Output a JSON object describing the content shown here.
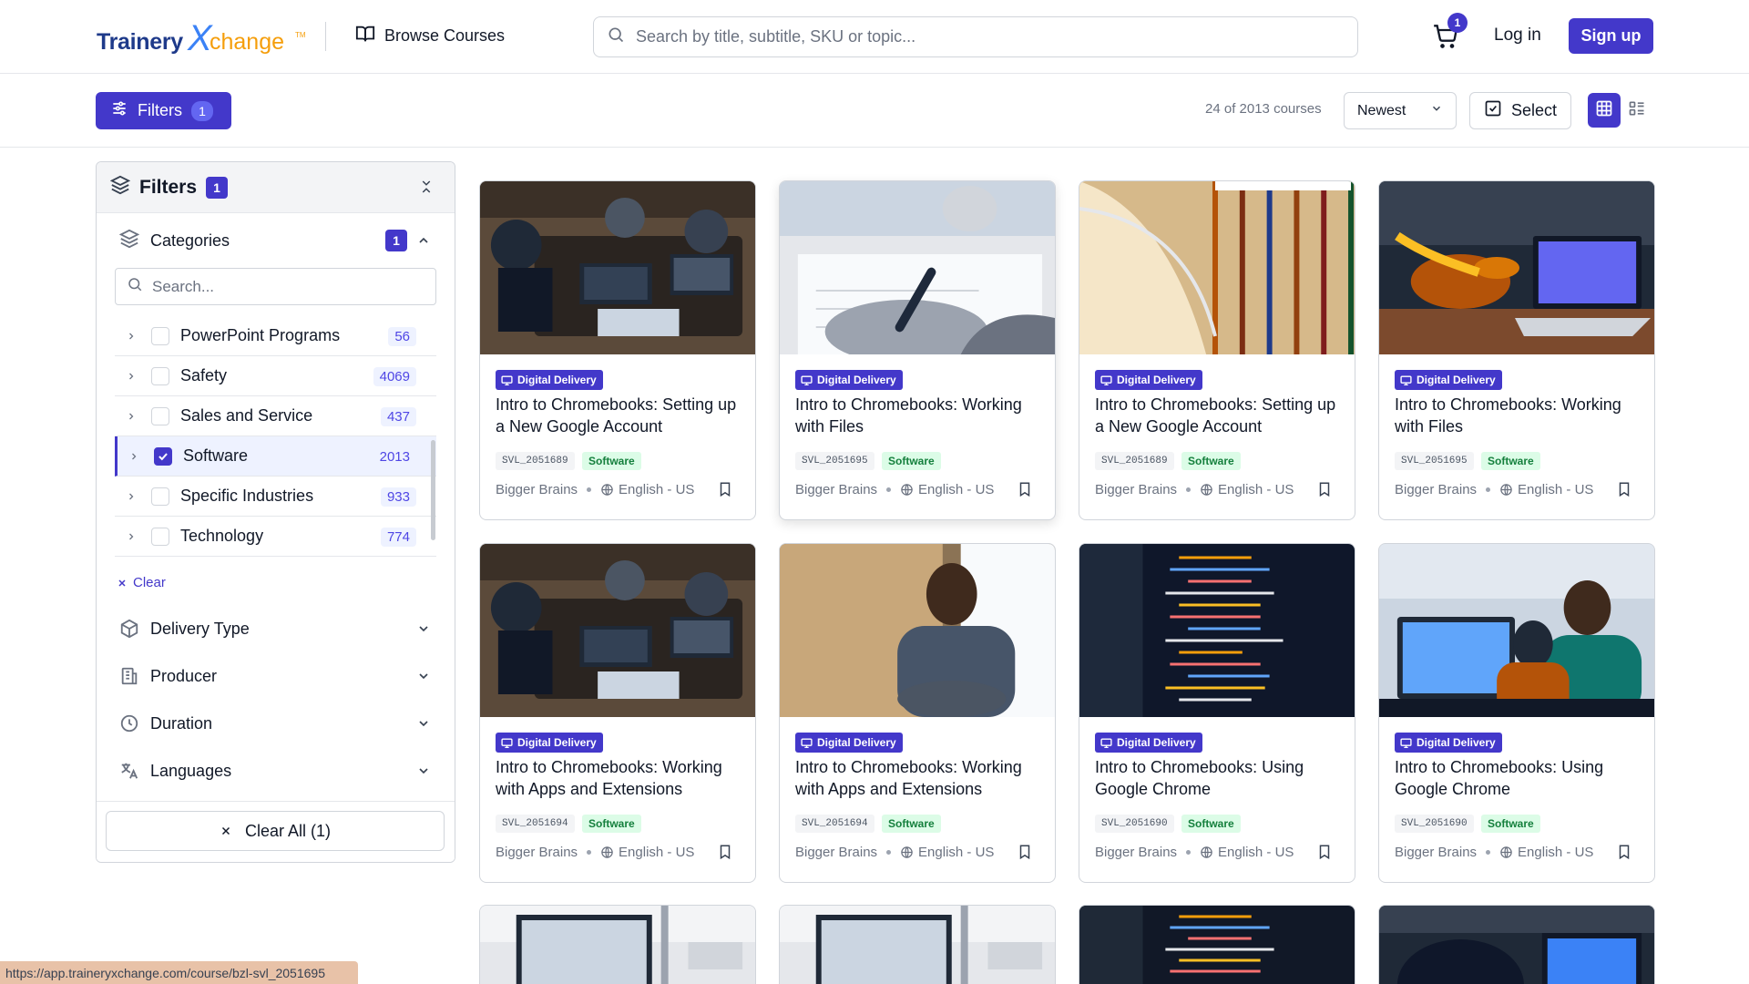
{
  "header": {
    "logo_text_1": "Trainery",
    "logo_text_x": "X",
    "logo_text_2": "change",
    "logo_tm": "TM",
    "browse_label": "Browse Courses",
    "search_placeholder": "Search by title, subtitle, SKU or topic...",
    "cart_count": "1",
    "login_label": "Log in",
    "signup_label": "Sign up"
  },
  "toolbar": {
    "filters_label": "Filters",
    "filters_count": "1",
    "course_count": "24 of 2013 courses",
    "sort_value": "Newest",
    "select_label": "Select"
  },
  "sidebar": {
    "title": "Filters",
    "count": "1",
    "categories": {
      "label": "Categories",
      "count": "1",
      "search_placeholder": "Search...",
      "items": [
        {
          "name": "PowerPoint Programs",
          "count": "56",
          "checked": false
        },
        {
          "name": "Safety",
          "count": "4069",
          "checked": false
        },
        {
          "name": "Sales and Service",
          "count": "437",
          "checked": false
        },
        {
          "name": "Software",
          "count": "2013",
          "checked": true
        },
        {
          "name": "Specific Industries",
          "count": "933",
          "checked": false
        },
        {
          "name": "Technology",
          "count": "774",
          "checked": false
        }
      ],
      "clear_label": "Clear"
    },
    "sections": {
      "delivery": "Delivery Type",
      "producer": "Producer",
      "duration": "Duration",
      "languages": "Languages"
    },
    "clear_all_label": "Clear All (1)"
  },
  "courses": [
    {
      "badge": "Digital Delivery",
      "title": "Intro to Chromebooks: Setting up a New Google Account",
      "sku": "SVL_2051689",
      "tag": "Software",
      "producer": "Bigger Brains",
      "language": "English - US",
      "image": "team-laptops"
    },
    {
      "badge": "Digital Delivery",
      "title": "Intro to Chromebooks: Working with Files",
      "sku": "SVL_2051695",
      "tag": "Software",
      "producer": "Bigger Brains",
      "language": "English - US",
      "image": "writing-hand"
    },
    {
      "badge": "Digital Delivery",
      "title": "Intro to Chromebooks: Setting up a New Google Account",
      "sku": "SVL_2051689",
      "tag": "Software",
      "producer": "Bigger Brains",
      "language": "English - US",
      "image": "library-shelves"
    },
    {
      "badge": "Digital Delivery",
      "title": "Intro to Chromebooks: Working with Files",
      "sku": "SVL_2051695",
      "tag": "Software",
      "producer": "Bigger Brains",
      "language": "English - US",
      "image": "laptop-hands"
    },
    {
      "badge": "Digital Delivery",
      "title": "Intro to Chromebooks: Working with Apps and Extensions",
      "sku": "SVL_2051694",
      "tag": "Software",
      "producer": "Bigger Brains",
      "language": "English - US",
      "image": "team-laptops"
    },
    {
      "badge": "Digital Delivery",
      "title": "Intro to Chromebooks: Working with Apps and Extensions",
      "sku": "SVL_2051694",
      "tag": "Software",
      "producer": "Bigger Brains",
      "language": "English - US",
      "image": "man-reading"
    },
    {
      "badge": "Digital Delivery",
      "title": "Intro to Chromebooks: Using Google Chrome",
      "sku": "SVL_2051690",
      "tag": "Software",
      "producer": "Bigger Brains",
      "language": "English - US",
      "image": "code-screen"
    },
    {
      "badge": "Digital Delivery",
      "title": "Intro to Chromebooks: Using Google Chrome",
      "sku": "SVL_2051690",
      "tag": "Software",
      "producer": "Bigger Brains",
      "language": "English - US",
      "image": "office-people"
    }
  ],
  "status_url": "https://app.traineryxchange.com/course/bzl-svl_2051695",
  "colors": {
    "primary": "#4338ca",
    "tag_bg": "#dcfce7",
    "tag_text": "#15803d",
    "count_bg": "#eef2ff"
  }
}
